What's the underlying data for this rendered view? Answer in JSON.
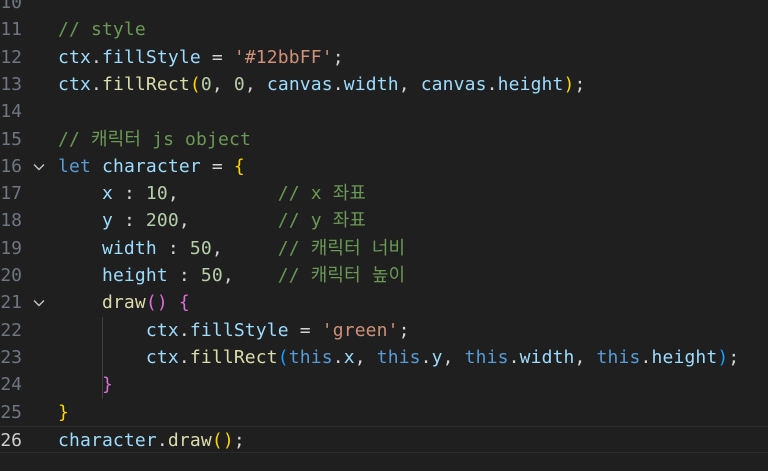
{
  "editor": {
    "lines": [
      {
        "number": "10",
        "fold": false,
        "active": false,
        "tokens": []
      },
      {
        "number": "11",
        "fold": false,
        "active": false,
        "tokens": [
          {
            "t": "// style",
            "c": "com"
          }
        ]
      },
      {
        "number": "12",
        "fold": false,
        "active": false,
        "tokens": [
          {
            "t": "ctx",
            "c": "var"
          },
          {
            "t": ".",
            "c": "pl"
          },
          {
            "t": "fillStyle",
            "c": "var"
          },
          {
            "t": " = ",
            "c": "pl"
          },
          {
            "t": "'#12bbFF'",
            "c": "str"
          },
          {
            "t": ";",
            "c": "pl"
          }
        ]
      },
      {
        "number": "13",
        "fold": false,
        "active": false,
        "tokens": [
          {
            "t": "ctx",
            "c": "var"
          },
          {
            "t": ".",
            "c": "pl"
          },
          {
            "t": "fillRect",
            "c": "fn"
          },
          {
            "t": "(",
            "c": "p1"
          },
          {
            "t": "0",
            "c": "num"
          },
          {
            "t": ", ",
            "c": "pl"
          },
          {
            "t": "0",
            "c": "num"
          },
          {
            "t": ", ",
            "c": "pl"
          },
          {
            "t": "canvas",
            "c": "var"
          },
          {
            "t": ".",
            "c": "pl"
          },
          {
            "t": "width",
            "c": "var"
          },
          {
            "t": ", ",
            "c": "pl"
          },
          {
            "t": "canvas",
            "c": "var"
          },
          {
            "t": ".",
            "c": "pl"
          },
          {
            "t": "height",
            "c": "var"
          },
          {
            "t": ")",
            "c": "p1"
          },
          {
            "t": ";",
            "c": "pl"
          }
        ]
      },
      {
        "number": "14",
        "fold": false,
        "active": false,
        "tokens": []
      },
      {
        "number": "15",
        "fold": false,
        "active": false,
        "tokens": [
          {
            "t": "// 캐릭터 js object",
            "c": "com"
          }
        ]
      },
      {
        "number": "16",
        "fold": true,
        "active": false,
        "tokens": [
          {
            "t": "let",
            "c": "kw"
          },
          {
            "t": " ",
            "c": "pl"
          },
          {
            "t": "character",
            "c": "var"
          },
          {
            "t": " = ",
            "c": "pl"
          },
          {
            "t": "{",
            "c": "p1"
          }
        ]
      },
      {
        "number": "17",
        "fold": false,
        "active": false,
        "tokens": [
          {
            "t": "    ",
            "c": "pl"
          },
          {
            "t": "x",
            "c": "var"
          },
          {
            "t": " : ",
            "c": "pl"
          },
          {
            "t": "10",
            "c": "num"
          },
          {
            "t": ",         ",
            "c": "pl"
          },
          {
            "t": "// x 좌표",
            "c": "com"
          }
        ]
      },
      {
        "number": "18",
        "fold": false,
        "active": false,
        "tokens": [
          {
            "t": "    ",
            "c": "pl"
          },
          {
            "t": "y",
            "c": "var"
          },
          {
            "t": " : ",
            "c": "pl"
          },
          {
            "t": "200",
            "c": "num"
          },
          {
            "t": ",        ",
            "c": "pl"
          },
          {
            "t": "// y 좌표",
            "c": "com"
          }
        ]
      },
      {
        "number": "19",
        "fold": false,
        "active": false,
        "tokens": [
          {
            "t": "    ",
            "c": "pl"
          },
          {
            "t": "width",
            "c": "var"
          },
          {
            "t": " : ",
            "c": "pl"
          },
          {
            "t": "50",
            "c": "num"
          },
          {
            "t": ",     ",
            "c": "pl"
          },
          {
            "t": "// 캐릭터 너비",
            "c": "com"
          }
        ]
      },
      {
        "number": "20",
        "fold": false,
        "active": false,
        "tokens": [
          {
            "t": "    ",
            "c": "pl"
          },
          {
            "t": "height",
            "c": "var"
          },
          {
            "t": " : ",
            "c": "pl"
          },
          {
            "t": "50",
            "c": "num"
          },
          {
            "t": ",    ",
            "c": "pl"
          },
          {
            "t": "// 캐릭터 높이",
            "c": "com"
          }
        ]
      },
      {
        "number": "21",
        "fold": true,
        "active": false,
        "tokens": [
          {
            "t": "    ",
            "c": "pl"
          },
          {
            "t": "draw",
            "c": "fn"
          },
          {
            "t": "()",
            "c": "p2"
          },
          {
            "t": " ",
            "c": "pl"
          },
          {
            "t": "{",
            "c": "p2"
          }
        ]
      },
      {
        "number": "22",
        "fold": false,
        "active": false,
        "tokens": [
          {
            "t": "        ",
            "c": "pl"
          },
          {
            "t": "ctx",
            "c": "var"
          },
          {
            "t": ".",
            "c": "pl"
          },
          {
            "t": "fillStyle",
            "c": "var"
          },
          {
            "t": " = ",
            "c": "pl"
          },
          {
            "t": "'green'",
            "c": "str"
          },
          {
            "t": ";",
            "c": "pl"
          }
        ]
      },
      {
        "number": "23",
        "fold": false,
        "active": false,
        "tokens": [
          {
            "t": "        ",
            "c": "pl"
          },
          {
            "t": "ctx",
            "c": "var"
          },
          {
            "t": ".",
            "c": "pl"
          },
          {
            "t": "fillRect",
            "c": "fn"
          },
          {
            "t": "(",
            "c": "p3"
          },
          {
            "t": "this",
            "c": "kw"
          },
          {
            "t": ".",
            "c": "pl"
          },
          {
            "t": "x",
            "c": "var"
          },
          {
            "t": ", ",
            "c": "pl"
          },
          {
            "t": "this",
            "c": "kw"
          },
          {
            "t": ".",
            "c": "pl"
          },
          {
            "t": "y",
            "c": "var"
          },
          {
            "t": ", ",
            "c": "pl"
          },
          {
            "t": "this",
            "c": "kw"
          },
          {
            "t": ".",
            "c": "pl"
          },
          {
            "t": "width",
            "c": "var"
          },
          {
            "t": ", ",
            "c": "pl"
          },
          {
            "t": "this",
            "c": "kw"
          },
          {
            "t": ".",
            "c": "pl"
          },
          {
            "t": "height",
            "c": "var"
          },
          {
            "t": ")",
            "c": "p3"
          },
          {
            "t": ";",
            "c": "pl"
          }
        ]
      },
      {
        "number": "24",
        "fold": false,
        "active": false,
        "tokens": [
          {
            "t": "    ",
            "c": "pl"
          },
          {
            "t": "}",
            "c": "p2"
          }
        ]
      },
      {
        "number": "25",
        "fold": false,
        "active": false,
        "tokens": [
          {
            "t": "}",
            "c": "p1"
          }
        ]
      },
      {
        "number": "26",
        "fold": false,
        "active": true,
        "tokens": [
          {
            "t": "character",
            "c": "var"
          },
          {
            "t": ".",
            "c": "pl"
          },
          {
            "t": "draw",
            "c": "fn"
          },
          {
            "t": "()",
            "c": "p1"
          },
          {
            "t": ";",
            "c": "pl"
          }
        ]
      }
    ]
  }
}
